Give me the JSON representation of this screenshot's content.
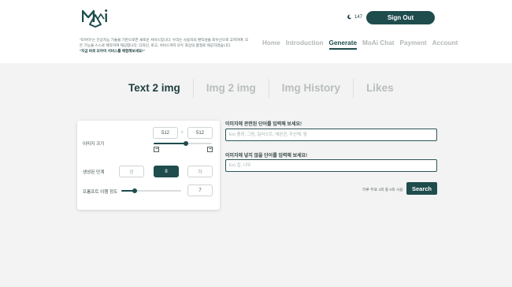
{
  "header": {
    "intro_text": "\"모아이\"는 인공지능 기술을 기반으로한 새로운 서비스입니다. 우리는 사용자의 편익성을 최우선으로 고려하여, 모든 기능을 스스로 제작하여 제공합니다. 디자인, 로고, 서비스까지 모두 최상의 품질로 제공하겠습니다.",
    "intro_cta": "\"지금 바로 모아이 서비스를 체험해보세요!\"",
    "credit_count": "147",
    "signout_label": "Sign Out",
    "nav": [
      {
        "label": "Home",
        "active": false
      },
      {
        "label": "Introduction",
        "active": false
      },
      {
        "label": "Generate",
        "active": true
      },
      {
        "label": "MoAi Chat",
        "active": false
      },
      {
        "label": "Payment",
        "active": false
      },
      {
        "label": "Account",
        "active": false
      }
    ]
  },
  "tabs": [
    {
      "label": "Text 2 img",
      "active": true
    },
    {
      "label": "Img 2 img",
      "active": false
    },
    {
      "label": "Img History",
      "active": false
    },
    {
      "label": "Likes",
      "active": false
    }
  ],
  "settings": {
    "size_label": "이미지 크기",
    "width_value": "512",
    "height_value": "512",
    "size_separator": "x",
    "size_slider_fraction": 0.55,
    "steps_label": "생성된 단계",
    "steps_options": [
      "상",
      "8",
      "하"
    ],
    "steps_selected_index": 1,
    "prompt_fidelity_label": "프롬프트 이행 정도",
    "prompt_fidelity_value": "7",
    "prompt_fidelity_fraction": 0.22
  },
  "prompt": {
    "positive_label": "이미지에 관련된 단어를 입력해 보세요!",
    "positive_placeholder": "Ex) 풍경, 그림, 일러스트, 애완견, 우산채, 밤",
    "negative_label": "이미지에 넣지 않을 단어를 입력해 보세요!",
    "negative_placeholder": "Ex) 집, 나무",
    "usage_hint": "하루 무료 3회 중 0회 사용",
    "search_label": "Search"
  },
  "colors": {
    "primary": "#1f4c4d",
    "background": "#f3f3f3"
  }
}
